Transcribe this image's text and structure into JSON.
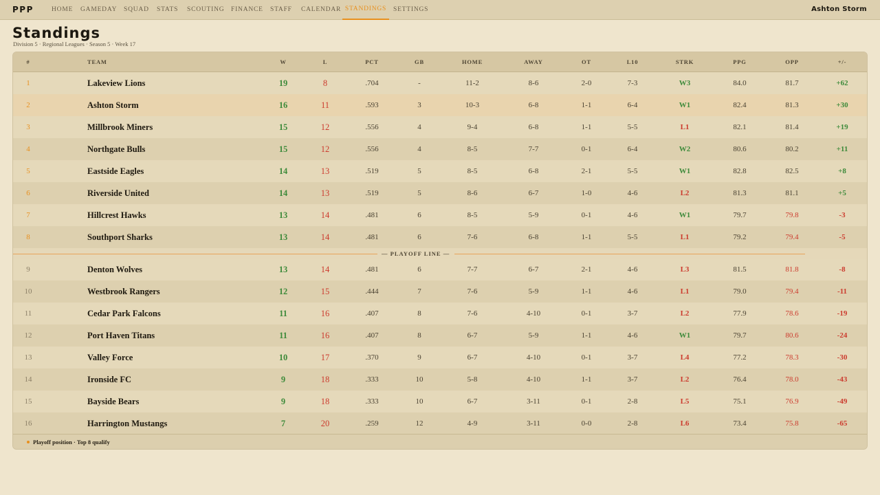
{
  "app": {
    "brand": "PPP",
    "user": "Ashton Storm"
  },
  "nav": {
    "items": [
      {
        "label": "HOME"
      },
      {
        "label": "GAMEDAY"
      },
      {
        "label": "SQUAD"
      },
      {
        "label": "STATS"
      },
      {
        "label": "SCOUTING"
      },
      {
        "label": "FINANCE"
      },
      {
        "label": "STAFF"
      },
      {
        "label": "CALENDAR"
      },
      {
        "label": "STANDINGS"
      },
      {
        "label": "SETTINGS"
      }
    ],
    "active": "STANDINGS"
  },
  "page": {
    "title": "Standings",
    "subtitle": "Division 5 · Regional Leagues · Season 5 · Week 17"
  },
  "colors": {
    "accent": "#e8901e",
    "win": "#3d8a3a",
    "loss": "#cc3b2e",
    "background": "#efe5cd"
  },
  "table": {
    "headers": {
      "rank": "#",
      "team": "TEAM",
      "w": "W",
      "l": "L",
      "pct": "PCT",
      "gb": "GB",
      "home": "HOME",
      "away": "AWAY",
      "ot": "OT",
      "l10": "L10",
      "strk": "STRK",
      "ppg": "PPG",
      "opp": "OPP",
      "pm": "+/-"
    },
    "rows": [
      {
        "rank": "1",
        "team": "Lakeview Lions",
        "w": "19",
        "l": "8",
        "pct": ".704",
        "gb": "-",
        "home": "11-2",
        "away": "8-6",
        "ot": "2-0",
        "l10": "7-3",
        "strk": "W3",
        "ppg": "84.0",
        "opp": "81.7",
        "pm": "+62"
      },
      {
        "rank": "2",
        "team": "Ashton Storm",
        "w": "16",
        "l": "11",
        "pct": ".593",
        "gb": "3",
        "home": "10-3",
        "away": "6-8",
        "ot": "1-1",
        "l10": "6-4",
        "strk": "W1",
        "ppg": "82.4",
        "opp": "81.3",
        "pm": "+30"
      },
      {
        "rank": "3",
        "team": "Millbrook Miners",
        "w": "15",
        "l": "12",
        "pct": ".556",
        "gb": "4",
        "home": "9-4",
        "away": "6-8",
        "ot": "1-1",
        "l10": "5-5",
        "strk": "L1",
        "ppg": "82.1",
        "opp": "81.4",
        "pm": "+19"
      },
      {
        "rank": "4",
        "team": "Northgate Bulls",
        "w": "15",
        "l": "12",
        "pct": ".556",
        "gb": "4",
        "home": "8-5",
        "away": "7-7",
        "ot": "0-1",
        "l10": "6-4",
        "strk": "W2",
        "ppg": "80.6",
        "opp": "80.2",
        "pm": "+11"
      },
      {
        "rank": "5",
        "team": "Eastside Eagles",
        "w": "14",
        "l": "13",
        "pct": ".519",
        "gb": "5",
        "home": "8-5",
        "away": "6-8",
        "ot": "2-1",
        "l10": "5-5",
        "strk": "W1",
        "ppg": "82.8",
        "opp": "82.5",
        "pm": "+8"
      },
      {
        "rank": "6",
        "team": "Riverside United",
        "w": "14",
        "l": "13",
        "pct": ".519",
        "gb": "5",
        "home": "8-6",
        "away": "6-7",
        "ot": "1-0",
        "l10": "4-6",
        "strk": "L2",
        "ppg": "81.3",
        "opp": "81.1",
        "pm": "+5"
      },
      {
        "rank": "7",
        "team": "Hillcrest Hawks",
        "w": "13",
        "l": "14",
        "pct": ".481",
        "gb": "6",
        "home": "8-5",
        "away": "5-9",
        "ot": "0-1",
        "l10": "4-6",
        "strk": "W1",
        "ppg": "79.7",
        "opp": "79.8",
        "pm": "-3"
      },
      {
        "rank": "8",
        "team": "Southport Sharks",
        "w": "13",
        "l": "14",
        "pct": ".481",
        "gb": "6",
        "home": "7-6",
        "away": "6-8",
        "ot": "1-1",
        "l10": "5-5",
        "strk": "L1",
        "ppg": "79.2",
        "opp": "79.4",
        "pm": "-5"
      },
      {
        "rank": "9",
        "team": "Denton Wolves",
        "w": "13",
        "l": "14",
        "pct": ".481",
        "gb": "6",
        "home": "7-7",
        "away": "6-7",
        "ot": "2-1",
        "l10": "4-6",
        "strk": "L3",
        "ppg": "81.5",
        "opp": "81.8",
        "pm": "-8"
      },
      {
        "rank": "10",
        "team": "Westbrook Rangers",
        "w": "12",
        "l": "15",
        "pct": ".444",
        "gb": "7",
        "home": "7-6",
        "away": "5-9",
        "ot": "1-1",
        "l10": "4-6",
        "strk": "L1",
        "ppg": "79.0",
        "opp": "79.4",
        "pm": "-11"
      },
      {
        "rank": "11",
        "team": "Cedar Park Falcons",
        "w": "11",
        "l": "16",
        "pct": ".407",
        "gb": "8",
        "home": "7-6",
        "away": "4-10",
        "ot": "0-1",
        "l10": "3-7",
        "strk": "L2",
        "ppg": "77.9",
        "opp": "78.6",
        "pm": "-19"
      },
      {
        "rank": "12",
        "team": "Port Haven Titans",
        "w": "11",
        "l": "16",
        "pct": ".407",
        "gb": "8",
        "home": "6-7",
        "away": "5-9",
        "ot": "1-1",
        "l10": "4-6",
        "strk": "W1",
        "ppg": "79.7",
        "opp": "80.6",
        "pm": "-24"
      },
      {
        "rank": "13",
        "team": "Valley Force",
        "w": "10",
        "l": "17",
        "pct": ".370",
        "gb": "9",
        "home": "6-7",
        "away": "4-10",
        "ot": "0-1",
        "l10": "3-7",
        "strk": "L4",
        "ppg": "77.2",
        "opp": "78.3",
        "pm": "-30"
      },
      {
        "rank": "14",
        "team": "Ironside FC",
        "w": "9",
        "l": "18",
        "pct": ".333",
        "gb": "10",
        "home": "5-8",
        "away": "4-10",
        "ot": "1-1",
        "l10": "3-7",
        "strk": "L2",
        "ppg": "76.4",
        "opp": "78.0",
        "pm": "-43"
      },
      {
        "rank": "15",
        "team": "Bayside Bears",
        "w": "9",
        "l": "18",
        "pct": ".333",
        "gb": "10",
        "home": "6-7",
        "away": "3-11",
        "ot": "0-1",
        "l10": "2-8",
        "strk": "L5",
        "ppg": "75.1",
        "opp": "76.9",
        "pm": "-49"
      },
      {
        "rank": "16",
        "team": "Harrington Mustangs",
        "w": "7",
        "l": "20",
        "pct": ".259",
        "gb": "12",
        "home": "4-9",
        "away": "3-11",
        "ot": "0-0",
        "l10": "2-8",
        "strk": "L6",
        "ppg": "73.4",
        "opp": "75.8",
        "pm": "-65"
      }
    ],
    "playoff_line_label": "— PLAYOFF LINE —",
    "playoff_spots": 8,
    "highlight_team": "Ashton Storm"
  },
  "footer": {
    "legend": "Playoff position · Top 8 qualify"
  }
}
